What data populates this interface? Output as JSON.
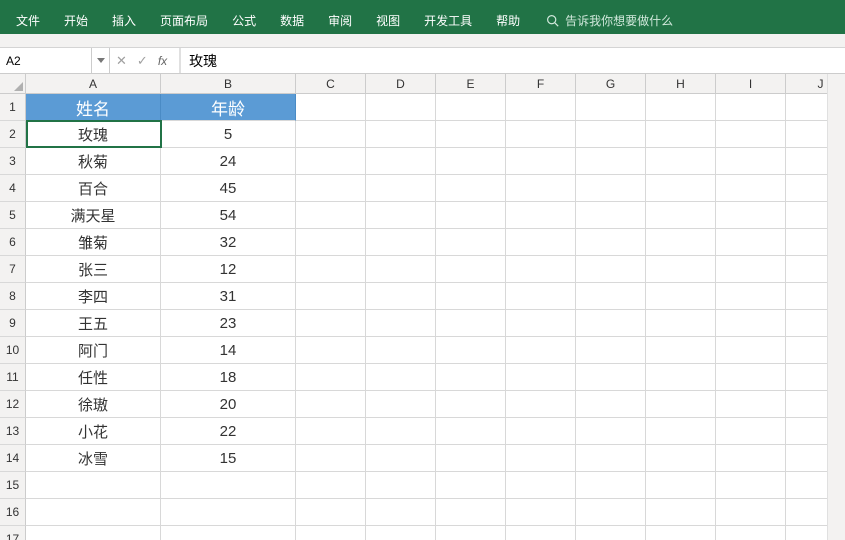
{
  "ribbon": {
    "tabs": [
      "文件",
      "开始",
      "插入",
      "页面布局",
      "公式",
      "数据",
      "审阅",
      "视图",
      "开发工具",
      "帮助"
    ],
    "tell_me": "告诉我你想要做什么"
  },
  "formula_bar": {
    "name_box": "A2",
    "cancel": "✕",
    "enter": "✓",
    "fx": "fx",
    "value": "玫瑰"
  },
  "grid": {
    "col_widths": {
      "A": 135,
      "B": 135,
      "other": 70
    },
    "columns": [
      "A",
      "B",
      "C",
      "D",
      "E",
      "F",
      "G",
      "H",
      "I",
      "J"
    ],
    "row_header_h": 27,
    "row_data_h": 27,
    "active_cell": "A2",
    "headers": {
      "A": "姓名",
      "B": "年龄"
    },
    "rows": [
      {
        "A": "玫瑰",
        "B": "5"
      },
      {
        "A": "秋菊",
        "B": "24"
      },
      {
        "A": "百合",
        "B": "45"
      },
      {
        "A": "满天星",
        "B": "54"
      },
      {
        "A": "雏菊",
        "B": "32"
      },
      {
        "A": "张三",
        "B": "12"
      },
      {
        "A": "李四",
        "B": "31"
      },
      {
        "A": "王五",
        "B": "23"
      },
      {
        "A": "阿门",
        "B": "14"
      },
      {
        "A": "任性",
        "B": "18"
      },
      {
        "A": "徐璈",
        "B": "20"
      },
      {
        "A": "小花",
        "B": "22"
      },
      {
        "A": "冰雪",
        "B": "15"
      }
    ],
    "visible_rows": 17
  }
}
